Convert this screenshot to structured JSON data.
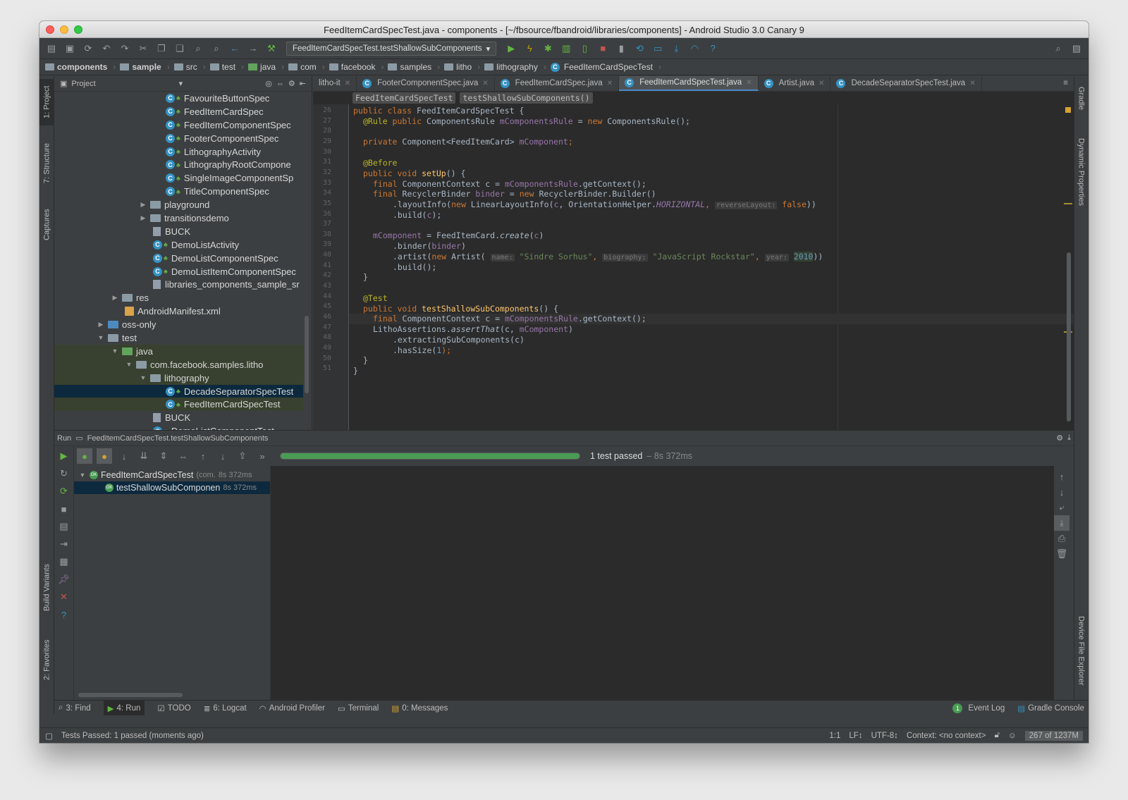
{
  "window_title": "FeedItemCardSpecTest.java - components - [~/fbsource/fbandroid/libraries/components] - Android Studio 3.0 Canary 9",
  "toolbar": {
    "run_config": "FeedItemCardSpecTest.testShallowSubComponents"
  },
  "breadcrumbs": [
    "components",
    "sample",
    "src",
    "test",
    "java",
    "com",
    "facebook",
    "samples",
    "litho",
    "lithography",
    "FeedItemCardSpecTest"
  ],
  "left_stripe": {
    "project": "1: Project",
    "structure": "7: Structure",
    "captures": "Captures",
    "build_variants": "Build Variants",
    "favorites": "2: Favorites"
  },
  "right_stripe": {
    "gradle": "Gradle",
    "dynamic_properties": "Dynamic Properties",
    "device_file_explorer": "Device File Explorer"
  },
  "project_panel": {
    "title": "Project",
    "items": [
      {
        "label": "FavouriteButtonSpec",
        "type": "class"
      },
      {
        "label": "FeedItemCardSpec",
        "type": "class"
      },
      {
        "label": "FeedItemComponentSpec",
        "type": "class"
      },
      {
        "label": "FooterComponentSpec",
        "type": "class"
      },
      {
        "label": "LithographyActivity",
        "type": "class"
      },
      {
        "label": "LithographyRootCompone",
        "type": "class"
      },
      {
        "label": "SingleImageComponentSp",
        "type": "class"
      },
      {
        "label": "TitleComponentSpec",
        "type": "class"
      },
      {
        "label": "playground",
        "type": "folder"
      },
      {
        "label": "transitionsdemo",
        "type": "folder"
      },
      {
        "label": "BUCK",
        "type": "file"
      },
      {
        "label": "DemoListActivity",
        "type": "class"
      },
      {
        "label": "DemoListComponentSpec",
        "type": "class"
      },
      {
        "label": "DemoListItemComponentSpec",
        "type": "class"
      },
      {
        "label": "libraries_components_sample_sr",
        "type": "file"
      },
      {
        "label": "res",
        "type": "folder"
      },
      {
        "label": "AndroidManifest.xml",
        "type": "xml"
      },
      {
        "label": "oss-only",
        "type": "folder"
      },
      {
        "label": "test",
        "type": "folder"
      },
      {
        "label": "java",
        "type": "folder"
      },
      {
        "label": "com.facebook.samples.litho",
        "type": "folder"
      },
      {
        "label": "lithography",
        "type": "folder"
      },
      {
        "label": "DecadeSeparatorSpecTest",
        "type": "class"
      },
      {
        "label": "FeedItemCardSpecTest",
        "type": "class"
      },
      {
        "label": "BUCK",
        "type": "file"
      },
      {
        "label": "DemoListComponentTest",
        "type": "class"
      }
    ]
  },
  "editor_tabs": [
    {
      "label": "litho-it"
    },
    {
      "label": "FooterComponentSpec.java"
    },
    {
      "label": "FeedItemCardSpec.java"
    },
    {
      "label": "FeedItemCardSpecTest.java"
    },
    {
      "label": "Artist.java"
    },
    {
      "label": "DecadeSeparatorSpecTest.java"
    }
  ],
  "editor_breadcrumb": [
    "FeedItemCardSpecTest",
    "testShallowSubComponents()"
  ],
  "line_numbers": [
    "26",
    "27",
    "28",
    "29",
    "30",
    "31",
    "32",
    "33",
    "34",
    "35",
    "36",
    "37",
    "38",
    "39",
    "40",
    "41",
    "42",
    "43",
    "44",
    "45",
    "46",
    "47",
    "48",
    "49",
    "50",
    "51"
  ],
  "code": {
    "l26_a": "public class ",
    "l26_b": "FeedItemCardSpecTest {",
    "l27_a": "@Rule ",
    "l27_b": "public ",
    "l27_c": "ComponentsRule ",
    "l27_d": "mComponentsRule",
    "l27_e": " = ",
    "l27_f": "new ",
    "l27_g": "ComponentsRule();",
    "l29_a": "private ",
    "l29_b": "Component<FeedItemCard> ",
    "l29_c": "mComponent",
    "l29_d": ";",
    "l31": "@Before",
    "l32_a": "public void ",
    "l32_b": "setUp",
    "l32_c": "() {",
    "l33_a": "final ",
    "l33_b": "ComponentContext c = ",
    "l33_c": "mComponentsRule",
    "l33_d": ".getContext();",
    "l34_a": "final ",
    "l34_b": "RecyclerBinder ",
    "l34_c": "binder",
    "l34_d": " = ",
    "l34_e": "new ",
    "l34_f": "RecyclerBinder.Builder()",
    "l35_a": ".layoutInfo(",
    "l35_b": "new ",
    "l35_c": "LinearLayoutInfo(",
    "l35_d": "c",
    "l35_e": ", OrientationHelper.",
    "l35_f": "HORIZONTAL",
    "l35_g": ",",
    "l35_h": "reverseLayout:",
    "l35_i": "false",
    "l35_j": "))",
    "l36_a": ".build(",
    "l36_b": "c",
    "l36_c": ");",
    "l38_a": "mComponent",
    "l38_b": " = FeedItemCard.",
    "l38_c": "create",
    "l38_d": "(",
    "l38_e": "c",
    "l38_f": ")",
    "l39_a": ".binder(",
    "l39_b": "binder",
    "l39_c": ")",
    "l40_a": ".artist(",
    "l40_b": "new ",
    "l40_c": "Artist(",
    "l40_d": "name:",
    "l40_e": "\"Sindre Sorhus\"",
    "l40_f": ",",
    "l40_g": "biography:",
    "l40_h": "\"JavaScript Rockstar\"",
    "l40_i": ",",
    "l40_j": "year:",
    "l40_k": "2010",
    "l40_l": "))",
    "l41": ".build();",
    "l42": "}",
    "l44": "@Test",
    "l45_a": "public void ",
    "l45_b": "testShallowSubComponents",
    "l45_c": "() {",
    "l46_a": "final ",
    "l46_b": "ComponentContext c = ",
    "l46_c": "mComponentsRule",
    "l46_d": ".getContext();",
    "l47_a": "LithoAssertions.",
    "l47_b": "assertThat",
    "l47_c": "(c, ",
    "l47_d": "mComponent",
    "l47_e": ")",
    "l48": ".extractingSubComponents(c)",
    "l49_a": ".hasSize(",
    "l49_b": "1",
    "l49_c": ");",
    "l50": "}",
    "l51": "}"
  },
  "run_panel": {
    "label": "Run",
    "config": "FeedItemCardSpecTest.testShallowSubComponents",
    "progress_fraction": 1.0,
    "result": "1 test passed",
    "result_time": "– 8s 372ms",
    "tests": [
      {
        "label": "FeedItemCardSpecTest",
        "extra": "(com.",
        "time": "8s 372ms"
      },
      {
        "label": "testShallowSubComponen",
        "time": "8s 372ms"
      }
    ]
  },
  "bottom_tabs": {
    "find": "3: Find",
    "run": "4: Run",
    "todo": "TODO",
    "logcat": "6: Logcat",
    "profiler": "Android Profiler",
    "terminal": "Terminal",
    "messages": "0: Messages",
    "event_log": "Event Log",
    "event_count": "1",
    "gradle_console": "Gradle Console"
  },
  "status_bar": {
    "message": "Tests Passed: 1 passed (moments ago)",
    "position": "1:1",
    "line_sep": "LF↕",
    "encoding": "UTF-8↕",
    "context": "Context: <no context>",
    "memory": "267 of 1237M"
  }
}
